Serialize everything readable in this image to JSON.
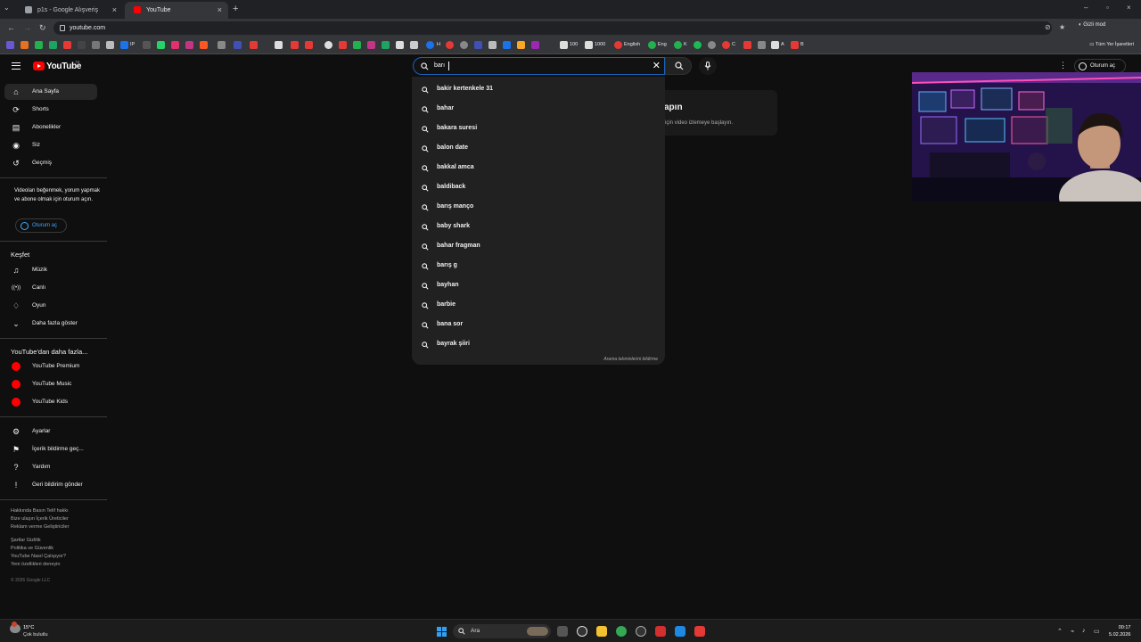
{
  "browser": {
    "tabs": [
      {
        "label": "p1s - Google Alışveriş",
        "active": false,
        "color": "#9aa0a6"
      },
      {
        "label": "YouTube",
        "active": true,
        "color": "#ff0000"
      }
    ],
    "address": "youtube.com",
    "profile_label": "Gizli mod",
    "bookmarks": [
      {
        "label": "IP"
      },
      {
        "label": "H"
      },
      {
        "label": "100"
      },
      {
        "label": "1000"
      },
      {
        "label": "English"
      },
      {
        "label": "Eng"
      },
      {
        "label": "K"
      },
      {
        "label": "C"
      },
      {
        "label": "A"
      },
      {
        "label": "B"
      }
    ],
    "all_bookmarks_label": "Tüm Yer İşaretleri"
  },
  "youtube": {
    "logo_text": "YouTube",
    "logo_country": "TR",
    "search_value": "barı",
    "signin_label": "Oturum aç",
    "sidebar": {
      "main": [
        {
          "label": "Ana Sayfa",
          "icon": "home-icon",
          "glyph": "⌂"
        },
        {
          "label": "Shorts",
          "icon": "shorts-icon",
          "glyph": "⟳"
        },
        {
          "label": "Abonelikler",
          "icon": "subscriptions-icon",
          "glyph": "▤"
        },
        {
          "label": "Siz",
          "icon": "you-icon",
          "glyph": "◉"
        },
        {
          "label": "Geçmiş",
          "icon": "history-icon",
          "glyph": "↺"
        }
      ],
      "signin_message": "Videoları beğenmek, yorum yapmak ve abone olmak için oturum açın.",
      "signin_button": "Oturum aç",
      "explore_heading": "Keşfet",
      "explore": [
        {
          "label": "Müzik",
          "icon": "music-icon",
          "glyph": "♫"
        },
        {
          "label": "Canlı",
          "icon": "live-icon",
          "glyph": "((•))"
        },
        {
          "label": "Oyun",
          "icon": "gaming-icon",
          "glyph": "♢"
        },
        {
          "label": "Daha fazla göster",
          "icon": "chevron-down-icon",
          "glyph": "⌄"
        }
      ],
      "more_heading": "YouTube'dan daha fazla...",
      "more": [
        {
          "label": "YouTube Premium"
        },
        {
          "label": "YouTube Music"
        },
        {
          "label": "YouTube Kids"
        }
      ],
      "settings": [
        {
          "label": "Ayarlar",
          "icon": "settings-icon",
          "glyph": "⚙"
        },
        {
          "label": "İçerik bildirme geç...",
          "icon": "flag-icon",
          "glyph": "⚑"
        },
        {
          "label": "Yardım",
          "icon": "help-icon",
          "glyph": "?"
        },
        {
          "label": "Geri bildirim gönder",
          "icon": "feedback-icon",
          "glyph": "!"
        }
      ],
      "footer_1": "Hakkında  Basın  Telif hakkı",
      "footer_2": "Bize ulaşın  İçerik Üreticiler",
      "footer_3": "Reklam verme  Geliştiriciler",
      "footer_4": "Şartlar  Gizlilik",
      "footer_5": "Politika ve Güvenlik",
      "footer_6": "YouTube Nasıl Çalışıyor?",
      "footer_7": "Yeni özellikleri deneyin",
      "copyright": "© 2026 Google LLC"
    },
    "card": {
      "title": "apın",
      "subtitle": "için video izlemeye başlayın."
    },
    "suggestions": [
      "bakir kertenkele 31",
      "bahar",
      "bakara suresi",
      "balon date",
      "bakkal amca",
      "baldiback",
      "barış manço",
      "baby shark",
      "bahar fragman",
      "barış g",
      "bayhan",
      "barbie",
      "bana sor",
      "bayrak şiiri"
    ],
    "report_label": "Arama tahminlerini bildirme"
  },
  "taskbar": {
    "temperature": "15°C",
    "condition": "Çok bulutlu",
    "search_placeholder": "Ara",
    "time": "00:17",
    "date": "5.02.2026"
  }
}
